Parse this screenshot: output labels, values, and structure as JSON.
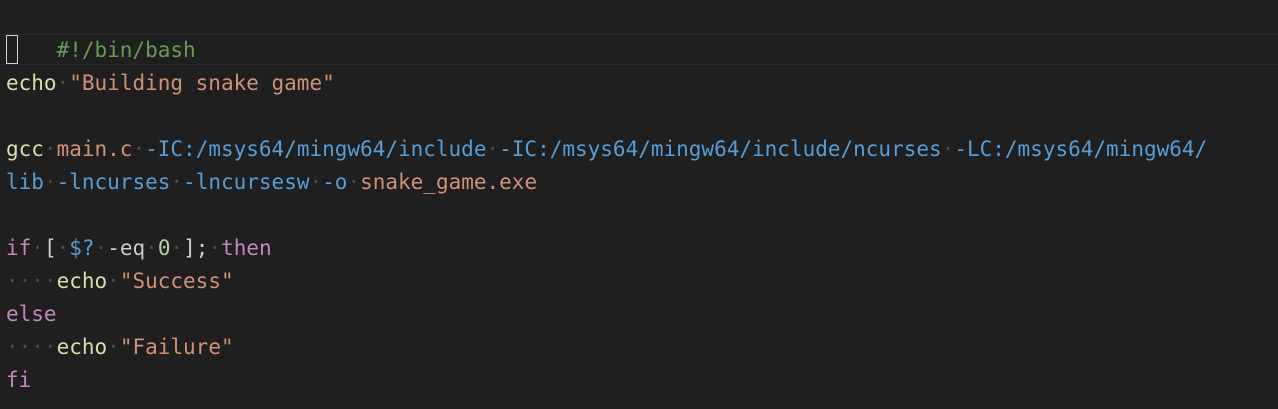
{
  "editor": {
    "language": "shell",
    "colors": {
      "background": "#1f1f1f",
      "comment": "#6a9955",
      "command": "#dcdcaa",
      "string": "#ce9178",
      "flag": "#569cd6",
      "keyword": "#c586c0",
      "variable": "#9cdcfe",
      "number": "#b5cea8",
      "whitespace_marker": "#4a4a4a"
    },
    "lines": {
      "l1": {
        "shebang": "#!/bin/bash"
      },
      "l3": {
        "cmd": "echo",
        "arg": "\"Building snake game\""
      },
      "l5": {
        "cmd": "gcc",
        "src": "main.c",
        "flag1": "-IC:/msys64/mingw64/include",
        "flag2": "-IC:/msys64/mingw64/include/ncurses",
        "flag3a": "-LC:/msys64/mingw64/"
      },
      "l6": {
        "flag3b": "lib",
        "flag4": "-lncurses",
        "flag5": "-lncursesw",
        "flag6": "-o",
        "out": "snake_game.exe"
      },
      "l8": {
        "kw_if": "if",
        "lb": "[",
        "var": "$?",
        "op": "-eq",
        "num": "0",
        "rb": "];",
        "kw_then": "then"
      },
      "l9": {
        "indent": "···",
        "cmd": "echo",
        "arg": "\"Success\""
      },
      "l10": {
        "kw": "else"
      },
      "l11": {
        "indent": "···",
        "cmd": "echo",
        "arg": "\"Failure\""
      },
      "l12": {
        "kw": "fi"
      }
    }
  }
}
